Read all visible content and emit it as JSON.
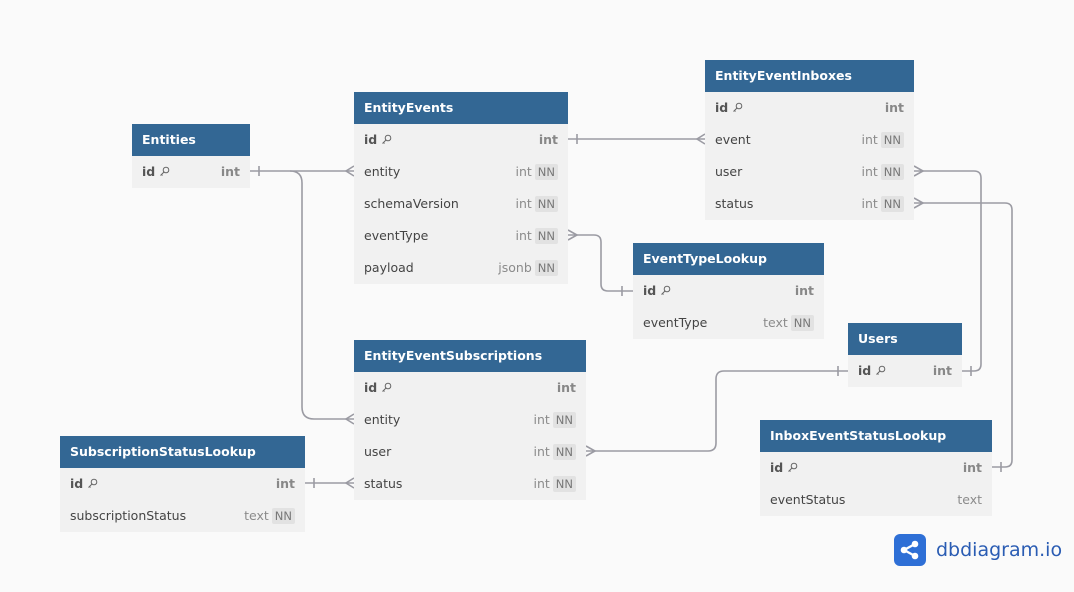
{
  "tables": [
    {
      "name": "Entities",
      "columns": [
        {
          "name": "id",
          "type": "int",
          "pk": true,
          "nn": false
        }
      ]
    },
    {
      "name": "EntityEvents",
      "columns": [
        {
          "name": "id",
          "type": "int",
          "pk": true,
          "nn": false
        },
        {
          "name": "entity",
          "type": "int",
          "pk": false,
          "nn": true
        },
        {
          "name": "schemaVersion",
          "type": "int",
          "pk": false,
          "nn": true
        },
        {
          "name": "eventType",
          "type": "int",
          "pk": false,
          "nn": true
        },
        {
          "name": "payload",
          "type": "jsonb",
          "pk": false,
          "nn": true
        }
      ]
    },
    {
      "name": "EntityEventInboxes",
      "columns": [
        {
          "name": "id",
          "type": "int",
          "pk": true,
          "nn": false
        },
        {
          "name": "event",
          "type": "int",
          "pk": false,
          "nn": true
        },
        {
          "name": "user",
          "type": "int",
          "pk": false,
          "nn": true
        },
        {
          "name": "status",
          "type": "int",
          "pk": false,
          "nn": true
        }
      ]
    },
    {
      "name": "EventTypeLookup",
      "columns": [
        {
          "name": "id",
          "type": "int",
          "pk": true,
          "nn": false
        },
        {
          "name": "eventType",
          "type": "text",
          "pk": false,
          "nn": true
        }
      ]
    },
    {
      "name": "EntityEventSubscriptions",
      "columns": [
        {
          "name": "id",
          "type": "int",
          "pk": true,
          "nn": false
        },
        {
          "name": "entity",
          "type": "int",
          "pk": false,
          "nn": true
        },
        {
          "name": "user",
          "type": "int",
          "pk": false,
          "nn": true
        },
        {
          "name": "status",
          "type": "int",
          "pk": false,
          "nn": true
        }
      ]
    },
    {
      "name": "SubscriptionStatusLookup",
      "columns": [
        {
          "name": "id",
          "type": "int",
          "pk": true,
          "nn": false
        },
        {
          "name": "subscriptionStatus",
          "type": "text",
          "pk": false,
          "nn": true
        }
      ]
    },
    {
      "name": "Users",
      "columns": [
        {
          "name": "id",
          "type": "int",
          "pk": true,
          "nn": false
        }
      ]
    },
    {
      "name": "InboxEventStatusLookup",
      "columns": [
        {
          "name": "id",
          "type": "int",
          "pk": true,
          "nn": false
        },
        {
          "name": "eventStatus",
          "type": "text",
          "pk": false,
          "nn": false
        }
      ]
    }
  ],
  "relations": [
    {
      "from": "EntityEvents.entity",
      "to": "Entities.id",
      "type": "many-to-one"
    },
    {
      "from": "EntityEventSubscriptions.entity",
      "to": "Entities.id",
      "type": "many-to-one"
    },
    {
      "from": "EntityEventInboxes.event",
      "to": "EntityEvents.id",
      "type": "many-to-one"
    },
    {
      "from": "EntityEvents.eventType",
      "to": "EventTypeLookup.id",
      "type": "many-to-one"
    },
    {
      "from": "EntityEventInboxes.user",
      "to": "Users.id",
      "type": "many-to-one"
    },
    {
      "from": "EntityEventInboxes.status",
      "to": "InboxEventStatusLookup.id",
      "type": "many-to-one"
    },
    {
      "from": "EntityEventSubscriptions.user",
      "to": "Users.id",
      "type": "many-to-one"
    },
    {
      "from": "EntityEventSubscriptions.status",
      "to": "SubscriptionStatusLookup.id",
      "type": "many-to-one"
    }
  ],
  "nn_label": "NN",
  "brand": {
    "name": "dbdiagram.io",
    "icon": "share-nodes-icon",
    "color": "#2e6fd6"
  },
  "colors": {
    "header": "#336794",
    "body": "#f1f1f1",
    "edge": "#9b9ba3"
  }
}
